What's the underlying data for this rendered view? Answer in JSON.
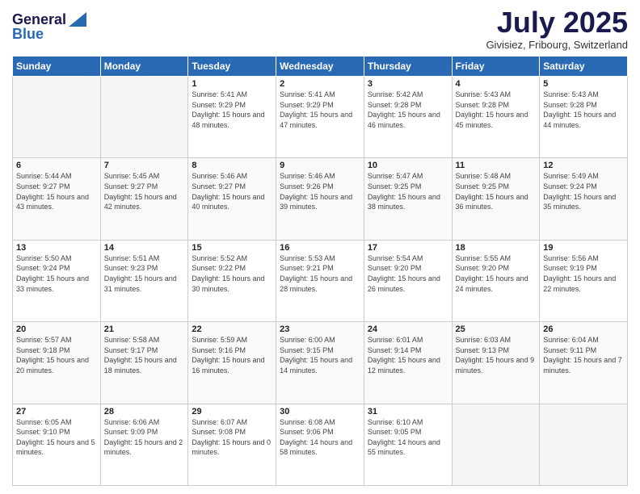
{
  "logo": {
    "line1": "General",
    "line2": "Blue"
  },
  "header": {
    "title": "July 2025",
    "subtitle": "Givisiez, Fribourg, Switzerland"
  },
  "weekdays": [
    "Sunday",
    "Monday",
    "Tuesday",
    "Wednesday",
    "Thursday",
    "Friday",
    "Saturday"
  ],
  "weeks": [
    [
      {
        "day": "",
        "sunrise": "",
        "sunset": "",
        "daylight": ""
      },
      {
        "day": "",
        "sunrise": "",
        "sunset": "",
        "daylight": ""
      },
      {
        "day": "1",
        "sunrise": "Sunrise: 5:41 AM",
        "sunset": "Sunset: 9:29 PM",
        "daylight": "Daylight: 15 hours and 48 minutes."
      },
      {
        "day": "2",
        "sunrise": "Sunrise: 5:41 AM",
        "sunset": "Sunset: 9:29 PM",
        "daylight": "Daylight: 15 hours and 47 minutes."
      },
      {
        "day": "3",
        "sunrise": "Sunrise: 5:42 AM",
        "sunset": "Sunset: 9:28 PM",
        "daylight": "Daylight: 15 hours and 46 minutes."
      },
      {
        "day": "4",
        "sunrise": "Sunrise: 5:43 AM",
        "sunset": "Sunset: 9:28 PM",
        "daylight": "Daylight: 15 hours and 45 minutes."
      },
      {
        "day": "5",
        "sunrise": "Sunrise: 5:43 AM",
        "sunset": "Sunset: 9:28 PM",
        "daylight": "Daylight: 15 hours and 44 minutes."
      }
    ],
    [
      {
        "day": "6",
        "sunrise": "Sunrise: 5:44 AM",
        "sunset": "Sunset: 9:27 PM",
        "daylight": "Daylight: 15 hours and 43 minutes."
      },
      {
        "day": "7",
        "sunrise": "Sunrise: 5:45 AM",
        "sunset": "Sunset: 9:27 PM",
        "daylight": "Daylight: 15 hours and 42 minutes."
      },
      {
        "day": "8",
        "sunrise": "Sunrise: 5:46 AM",
        "sunset": "Sunset: 9:27 PM",
        "daylight": "Daylight: 15 hours and 40 minutes."
      },
      {
        "day": "9",
        "sunrise": "Sunrise: 5:46 AM",
        "sunset": "Sunset: 9:26 PM",
        "daylight": "Daylight: 15 hours and 39 minutes."
      },
      {
        "day": "10",
        "sunrise": "Sunrise: 5:47 AM",
        "sunset": "Sunset: 9:25 PM",
        "daylight": "Daylight: 15 hours and 38 minutes."
      },
      {
        "day": "11",
        "sunrise": "Sunrise: 5:48 AM",
        "sunset": "Sunset: 9:25 PM",
        "daylight": "Daylight: 15 hours and 36 minutes."
      },
      {
        "day": "12",
        "sunrise": "Sunrise: 5:49 AM",
        "sunset": "Sunset: 9:24 PM",
        "daylight": "Daylight: 15 hours and 35 minutes."
      }
    ],
    [
      {
        "day": "13",
        "sunrise": "Sunrise: 5:50 AM",
        "sunset": "Sunset: 9:24 PM",
        "daylight": "Daylight: 15 hours and 33 minutes."
      },
      {
        "day": "14",
        "sunrise": "Sunrise: 5:51 AM",
        "sunset": "Sunset: 9:23 PM",
        "daylight": "Daylight: 15 hours and 31 minutes."
      },
      {
        "day": "15",
        "sunrise": "Sunrise: 5:52 AM",
        "sunset": "Sunset: 9:22 PM",
        "daylight": "Daylight: 15 hours and 30 minutes."
      },
      {
        "day": "16",
        "sunrise": "Sunrise: 5:53 AM",
        "sunset": "Sunset: 9:21 PM",
        "daylight": "Daylight: 15 hours and 28 minutes."
      },
      {
        "day": "17",
        "sunrise": "Sunrise: 5:54 AM",
        "sunset": "Sunset: 9:20 PM",
        "daylight": "Daylight: 15 hours and 26 minutes."
      },
      {
        "day": "18",
        "sunrise": "Sunrise: 5:55 AM",
        "sunset": "Sunset: 9:20 PM",
        "daylight": "Daylight: 15 hours and 24 minutes."
      },
      {
        "day": "19",
        "sunrise": "Sunrise: 5:56 AM",
        "sunset": "Sunset: 9:19 PM",
        "daylight": "Daylight: 15 hours and 22 minutes."
      }
    ],
    [
      {
        "day": "20",
        "sunrise": "Sunrise: 5:57 AM",
        "sunset": "Sunset: 9:18 PM",
        "daylight": "Daylight: 15 hours and 20 minutes."
      },
      {
        "day": "21",
        "sunrise": "Sunrise: 5:58 AM",
        "sunset": "Sunset: 9:17 PM",
        "daylight": "Daylight: 15 hours and 18 minutes."
      },
      {
        "day": "22",
        "sunrise": "Sunrise: 5:59 AM",
        "sunset": "Sunset: 9:16 PM",
        "daylight": "Daylight: 15 hours and 16 minutes."
      },
      {
        "day": "23",
        "sunrise": "Sunrise: 6:00 AM",
        "sunset": "Sunset: 9:15 PM",
        "daylight": "Daylight: 15 hours and 14 minutes."
      },
      {
        "day": "24",
        "sunrise": "Sunrise: 6:01 AM",
        "sunset": "Sunset: 9:14 PM",
        "daylight": "Daylight: 15 hours and 12 minutes."
      },
      {
        "day": "25",
        "sunrise": "Sunrise: 6:03 AM",
        "sunset": "Sunset: 9:13 PM",
        "daylight": "Daylight: 15 hours and 9 minutes."
      },
      {
        "day": "26",
        "sunrise": "Sunrise: 6:04 AM",
        "sunset": "Sunset: 9:11 PM",
        "daylight": "Daylight: 15 hours and 7 minutes."
      }
    ],
    [
      {
        "day": "27",
        "sunrise": "Sunrise: 6:05 AM",
        "sunset": "Sunset: 9:10 PM",
        "daylight": "Daylight: 15 hours and 5 minutes."
      },
      {
        "day": "28",
        "sunrise": "Sunrise: 6:06 AM",
        "sunset": "Sunset: 9:09 PM",
        "daylight": "Daylight: 15 hours and 2 minutes."
      },
      {
        "day": "29",
        "sunrise": "Sunrise: 6:07 AM",
        "sunset": "Sunset: 9:08 PM",
        "daylight": "Daylight: 15 hours and 0 minutes."
      },
      {
        "day": "30",
        "sunrise": "Sunrise: 6:08 AM",
        "sunset": "Sunset: 9:06 PM",
        "daylight": "Daylight: 14 hours and 58 minutes."
      },
      {
        "day": "31",
        "sunrise": "Sunrise: 6:10 AM",
        "sunset": "Sunset: 9:05 PM",
        "daylight": "Daylight: 14 hours and 55 minutes."
      },
      {
        "day": "",
        "sunrise": "",
        "sunset": "",
        "daylight": ""
      },
      {
        "day": "",
        "sunrise": "",
        "sunset": "",
        "daylight": ""
      }
    ]
  ]
}
